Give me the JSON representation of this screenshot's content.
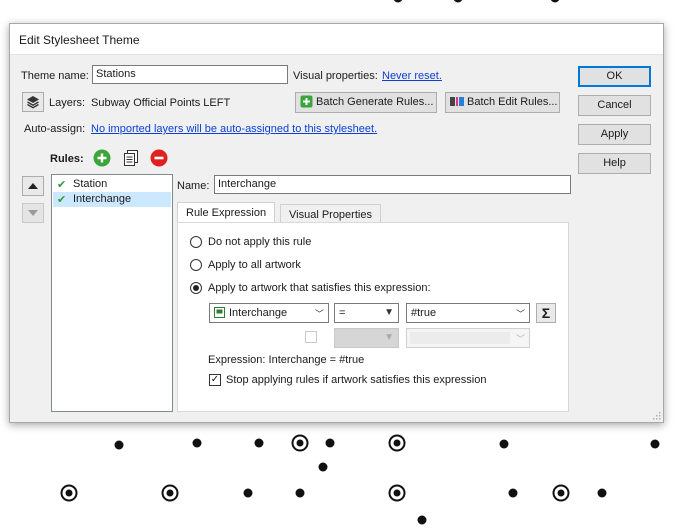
{
  "dialog": {
    "title": "Edit Stylesheet Theme",
    "theme_name_label": "Theme name:",
    "theme_name_value": "Stations",
    "visual_properties_label": "Visual properties:",
    "visual_properties_link": "Never reset.",
    "layers_label": "Layers:",
    "layers_value": "Subway Official Points LEFT",
    "batch_generate_label": "Batch Generate Rules...",
    "batch_edit_label": "Batch Edit Rules...",
    "auto_assign_label": "Auto-assign:",
    "auto_assign_link": "No imported layers will be auto-assigned to this stylesheet.",
    "rules_label": "Rules:",
    "buttons": {
      "ok": "OK",
      "cancel": "Cancel",
      "apply": "Apply",
      "help": "Help"
    },
    "rules": [
      {
        "name": "Station",
        "checked": true,
        "selected": false
      },
      {
        "name": "Interchange",
        "checked": true,
        "selected": true
      }
    ],
    "name_label": "Name:",
    "name_value": "Interchange",
    "tabs": [
      {
        "label": "Rule Expression",
        "active": true
      },
      {
        "label": "Visual Properties",
        "active": false
      }
    ],
    "rule_expression": {
      "opt_none": "Do not apply this rule",
      "opt_all": "Apply to all artwork",
      "opt_expr": "Apply to artwork that satisfies this expression:",
      "selected_option": "opt_expr",
      "attribute": "Interchange",
      "operator": "=",
      "value": "#true",
      "expression_text": "Expression: Interchange = #true",
      "stop_label": "Stop applying rules if artwork satisfies this expression",
      "stop_checked": true
    }
  },
  "colors": {
    "accent": "#0078d7",
    "link": "#0b3fd6",
    "add_green": "#3aa53a",
    "remove_red": "#e02020",
    "selection": "#cce8ff"
  },
  "icons": {
    "layers": "layers-icon",
    "add": "add-rule-icon",
    "duplicate": "duplicate-rule-icon",
    "remove": "remove-rule-icon",
    "up": "move-up-icon",
    "down": "move-down-icon",
    "sigma": "sigma-icon"
  }
}
